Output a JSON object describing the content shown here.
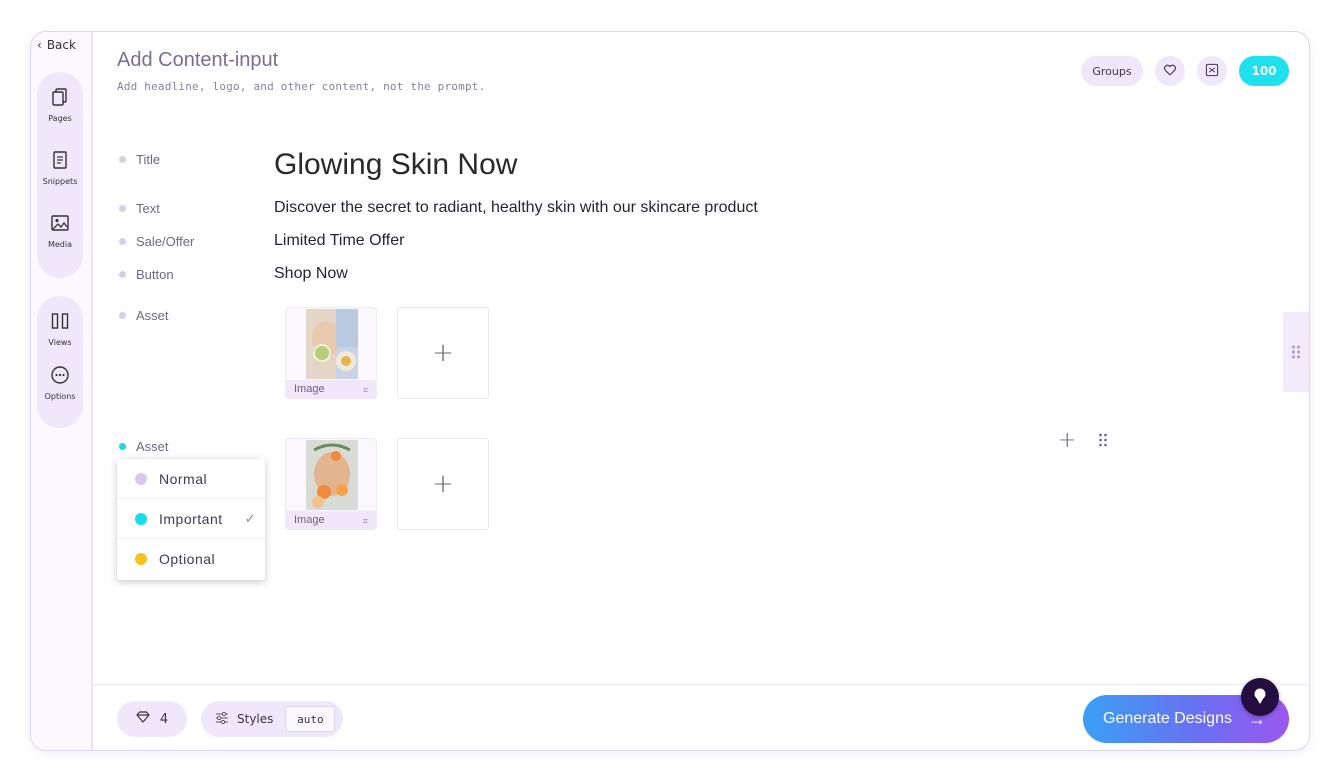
{
  "nav": {
    "back_label": "Back",
    "group1": [
      {
        "label": "Pages",
        "icon": "pages-icon"
      },
      {
        "label": "Snippets",
        "icon": "snippets-icon"
      },
      {
        "label": "Media",
        "icon": "media-icon"
      }
    ],
    "group2": [
      {
        "label": "Views",
        "icon": "views-icon"
      },
      {
        "label": "Options",
        "icon": "options-icon"
      }
    ]
  },
  "header": {
    "title": "Add Content-input",
    "subtitle": "Add headline, logo, and other content, not the prompt.",
    "groups_label": "Groups",
    "credits": "100"
  },
  "content": {
    "title_label": "Title",
    "title_value": "Glowing Skin Now",
    "text_label": "Text",
    "text_value": "Discover the secret to radiant, healthy skin with our skincare product",
    "sale_label": "Sale/Offer",
    "sale_value": "Limited Time Offer",
    "button_label": "Button",
    "button_value": "Shop Now",
    "asset1_label": "Asset",
    "asset1_caption": "Image",
    "asset2_label": "Asset",
    "asset2_caption": "Image",
    "add_symbol": "+"
  },
  "priority_menu": {
    "items": [
      {
        "label": "Normal",
        "color": "#d8c8f0"
      },
      {
        "label": "Important",
        "color": "#17dced",
        "selected": true
      },
      {
        "label": "Optional",
        "color": "#f6c21c"
      }
    ],
    "check": "✓"
  },
  "footer": {
    "count": "4",
    "styles_label": "Styles",
    "styles_value": "auto",
    "generate_label": "Generate Designs",
    "generate_arrow": "→"
  },
  "colors": {
    "accent": "#1ee0ee",
    "rail_bg": "#efe8fb",
    "title": "#7b6c93"
  }
}
